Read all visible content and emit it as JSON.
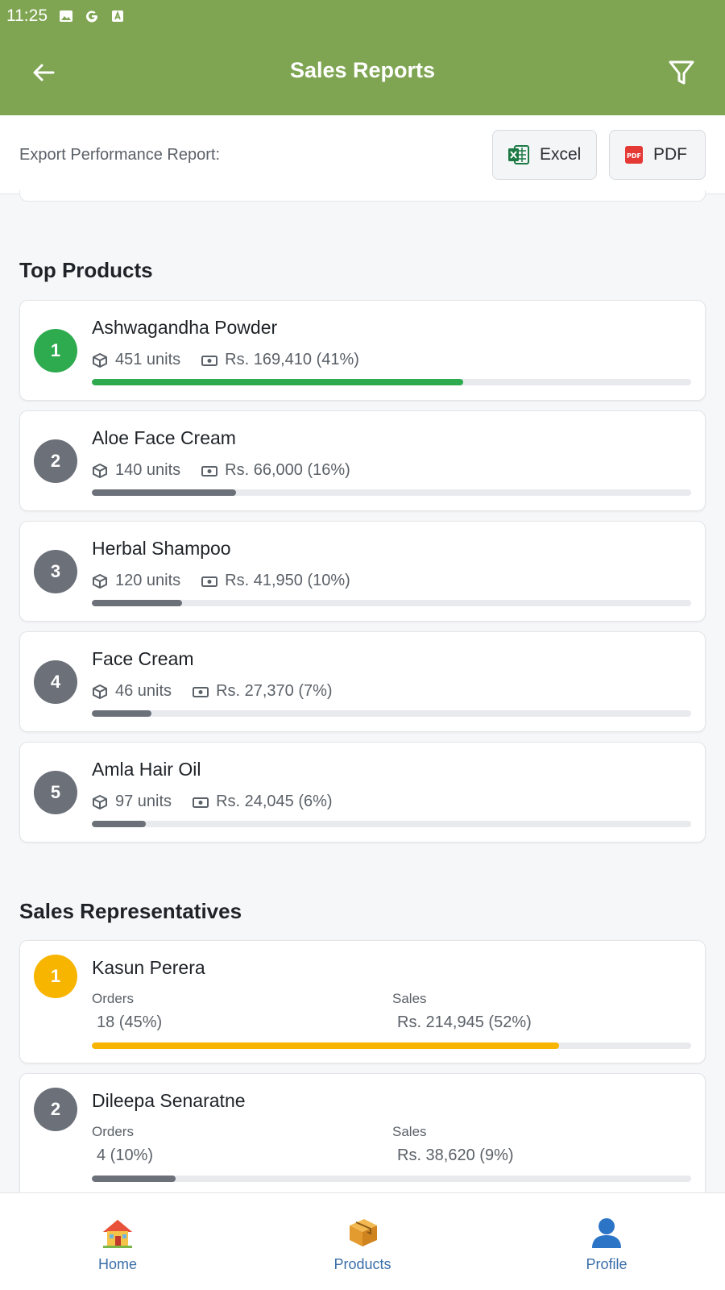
{
  "status_bar": {
    "time": "11:25"
  },
  "header": {
    "title": "Sales Reports"
  },
  "export": {
    "label": "Export Performance Report:",
    "excel_label": "Excel",
    "pdf_label": "PDF"
  },
  "top_products": {
    "title": "Top Products",
    "items": [
      {
        "rank": "1",
        "name": "Ashwagandha Powder",
        "units": "451 units",
        "sales": "Rs. 169,410 (41%)",
        "progress": 0.62,
        "color": "#2eaa4f"
      },
      {
        "rank": "2",
        "name": "Aloe Face Cream",
        "units": "140 units",
        "sales": "Rs. 66,000 (16%)",
        "progress": 0.24,
        "color": "#6b7079"
      },
      {
        "rank": "3",
        "name": "Herbal Shampoo",
        "units": "120 units",
        "sales": "Rs. 41,950 (10%)",
        "progress": 0.15,
        "color": "#6b7079"
      },
      {
        "rank": "4",
        "name": "Face Cream",
        "units": "46 units",
        "sales": "Rs. 27,370 (7%)",
        "progress": 0.1,
        "color": "#6b7079"
      },
      {
        "rank": "5",
        "name": "Amla Hair Oil",
        "units": "97 units",
        "sales": "Rs. 24,045 (6%)",
        "progress": 0.09,
        "color": "#6b7079"
      }
    ]
  },
  "sales_reps": {
    "title": "Sales Representatives",
    "orders_label": "Orders",
    "sales_label": "Sales",
    "items": [
      {
        "rank": "1",
        "name": "Kasun Perera",
        "orders": "18 (45%)",
        "sales": "Rs. 214,945 (52%)",
        "progress": 0.78,
        "color": "#f7b500"
      },
      {
        "rank": "2",
        "name": "Dileepa Senaratne",
        "orders": "4 (10%)",
        "sales": "Rs. 38,620 (9%)",
        "progress": 0.14,
        "color": "#6b7079"
      }
    ]
  },
  "bottom_nav": {
    "items": [
      {
        "label": "Home",
        "icon": "house-icon"
      },
      {
        "label": "Products",
        "icon": "package-icon"
      },
      {
        "label": "Profile",
        "icon": "person-icon"
      }
    ]
  },
  "colors": {
    "app_bar": "#7fa553",
    "accent_green": "#2eaa4f",
    "accent_gold": "#f7b500",
    "neutral": "#6b7079"
  }
}
